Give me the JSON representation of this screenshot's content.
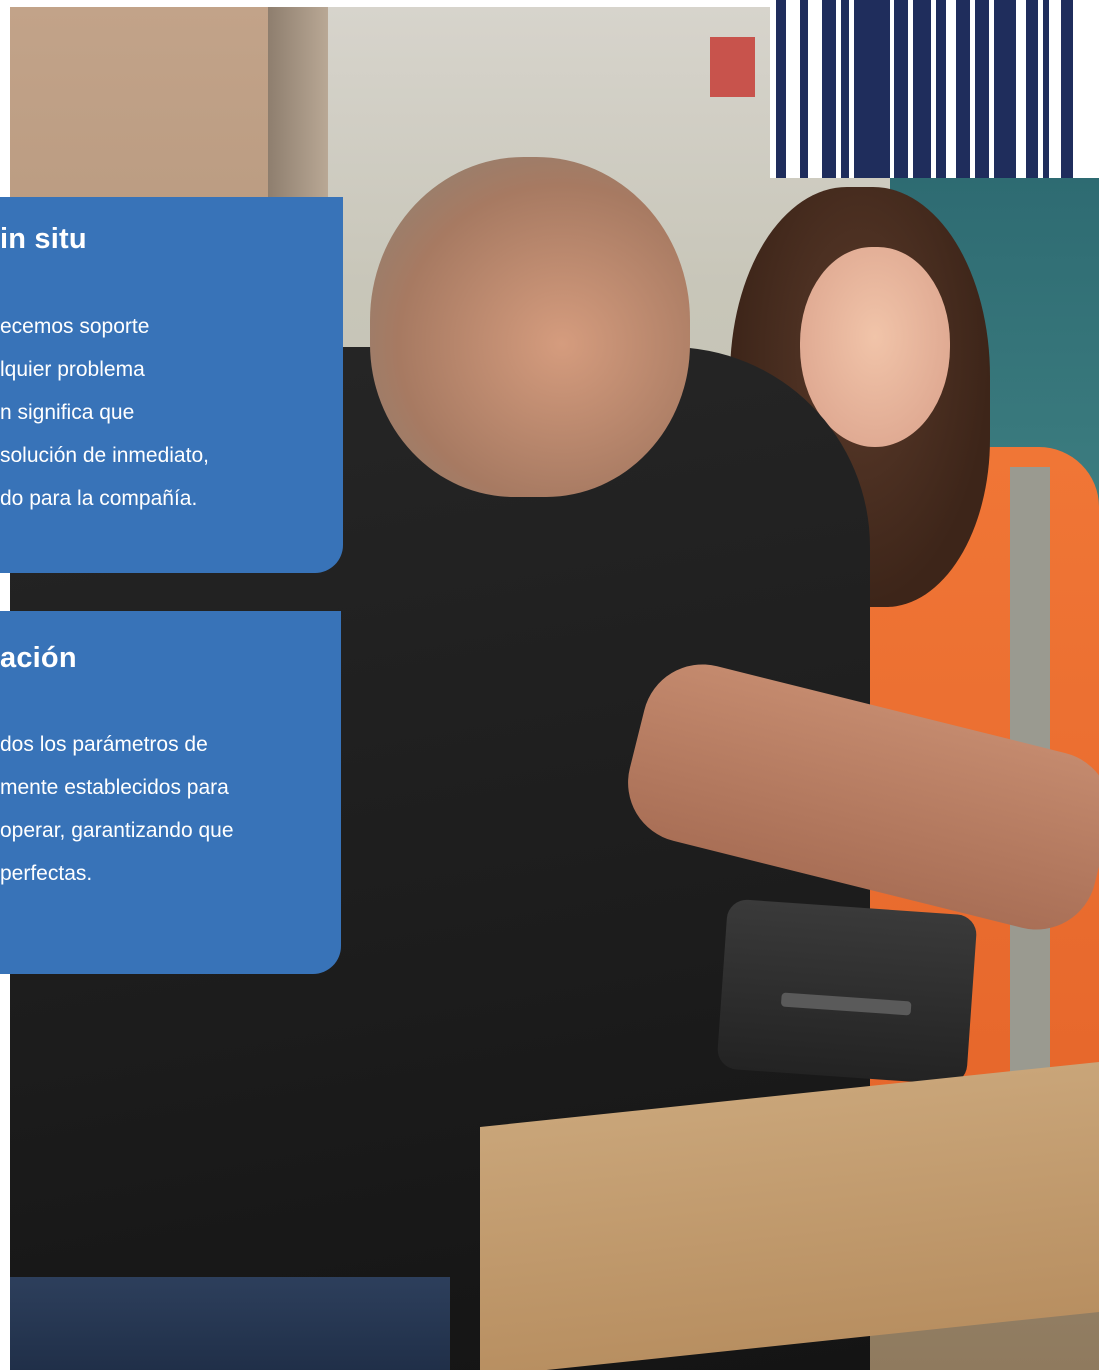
{
  "panels": [
    {
      "title": "in situ",
      "lines": [
        "ecemos soporte",
        "lquier problema",
        "n significa que",
        "solución de inmediato,",
        "do para la compañía."
      ]
    },
    {
      "title": "ación",
      "lines": [
        "dos los parámetros de",
        "mente establecidos para",
        "operar, garantizando que",
        " perfectas."
      ]
    }
  ],
  "colors": {
    "panel_blue": "#3873b8",
    "barcode_navy": "#1f2d5c",
    "vest_orange": "#f07636"
  },
  "decorations": {
    "barcode": "barcode-graphic",
    "photo": "warehouse-workers-photo"
  }
}
